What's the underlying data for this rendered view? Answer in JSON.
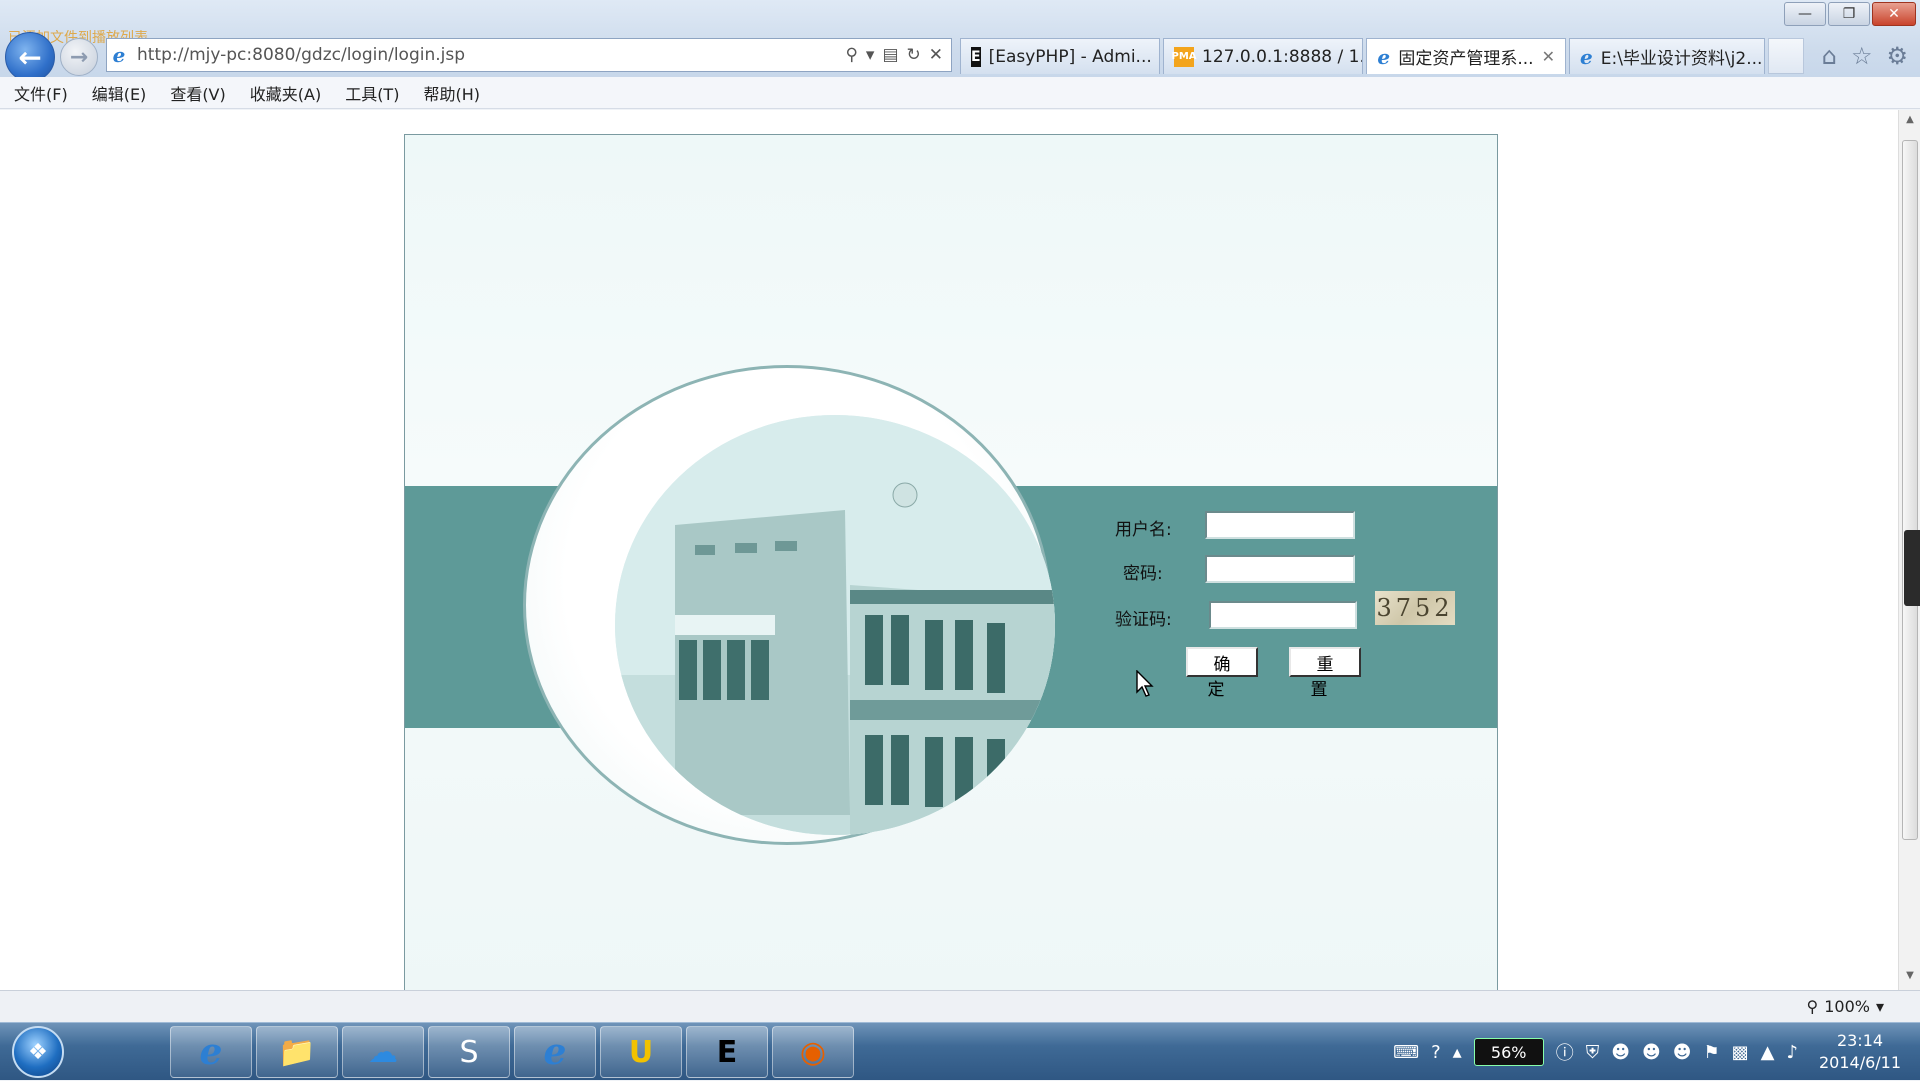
{
  "overlay": {
    "text": "已添加文件到播放列表"
  },
  "address": {
    "url": "http://mjy-pc:8080/gdzc/login/login.jsp"
  },
  "tabs": [
    {
      "label": "[EasyPHP] - Admi...",
      "icon": "easyphp-icon"
    },
    {
      "label": "127.0.0.1:8888 / 1...",
      "icon": "phpmyadmin-icon"
    },
    {
      "label": "固定资产管理系...",
      "icon": "ie-page-icon",
      "active": true
    },
    {
      "label": "E:\\毕业设计资料\\j2...",
      "icon": "ie-page-icon"
    }
  ],
  "menu": [
    "文件(F)",
    "编辑(E)",
    "查看(V)",
    "收藏夹(A)",
    "工具(T)",
    "帮助(H)"
  ],
  "login": {
    "username_label": "用户名:",
    "password_label": "密码:",
    "captcha_label": "验证码:",
    "captcha_value": "3752",
    "confirm_label": "确定",
    "reset_label": "重置",
    "username_value": "",
    "password_value": "",
    "captcha_input_value": ""
  },
  "status": {
    "zoom": "100%"
  },
  "taskbar": {
    "apps": [
      "internet-explorer",
      "file-explorer",
      "baidu-cloud",
      "sublime-text",
      "internet-explorer",
      "ultraedit",
      "easyphp",
      "firefox"
    ],
    "battery": "56%",
    "time": "23:14",
    "date": "2014/6/11"
  },
  "colors": {
    "teal_band": "#5e9a98",
    "panel": "#eef8f8"
  }
}
